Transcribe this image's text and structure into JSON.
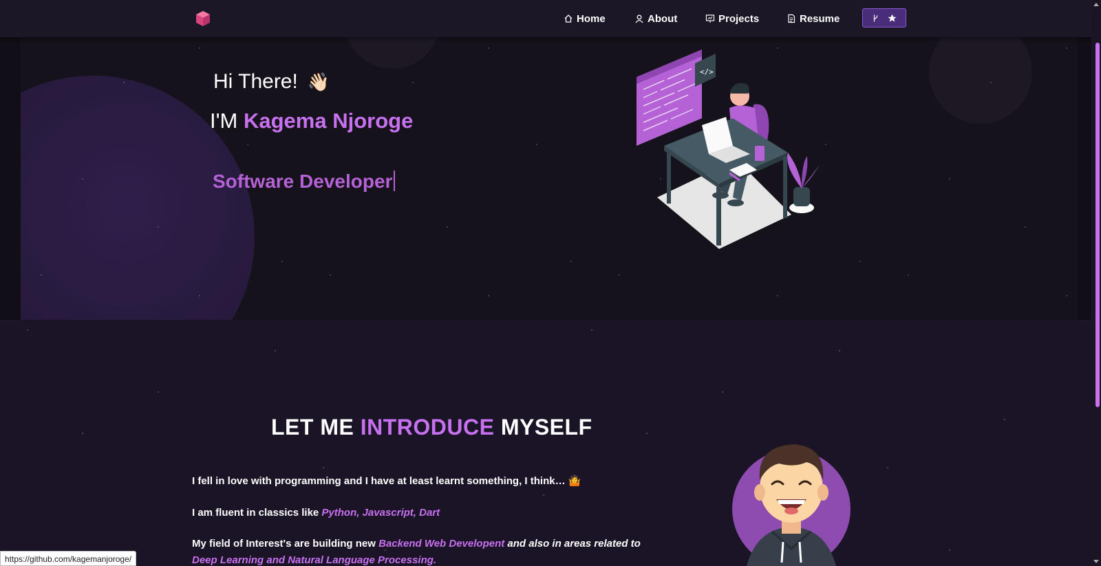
{
  "nav": {
    "items": [
      {
        "label": "Home",
        "icon": "home-icon"
      },
      {
        "label": "About",
        "icon": "user-icon"
      },
      {
        "label": "Projects",
        "icon": "projects-icon"
      },
      {
        "label": "Resume",
        "icon": "document-icon"
      }
    ],
    "github_button": {
      "icons": [
        "fork-icon",
        "star-icon"
      ]
    }
  },
  "hero": {
    "greeting": "Hi There!",
    "greeting_emoji": "👋🏻",
    "name_prefix": "I'M",
    "name": "Kagema Njoroge",
    "role": "Software Developer"
  },
  "intro": {
    "title_part1": "LET ME",
    "title_accent": "INTRODUCE",
    "title_part2": "MYSELF",
    "p1": "I fell in love with programming and I have at least learnt something, I think…",
    "p1_emoji": "🤷",
    "p2_prefix": "I am fluent in classics like",
    "p2_highlight": "Python, Javascript, Dart",
    "p3_prefix": "My field of Interest's are building new",
    "p3_highlight1": "Backend Web Developent",
    "p3_middle": "and also in areas related to",
    "p3_highlight2": "Deep Learning and Natural Language Processing."
  },
  "status_url": "https://github.com/kagemanjoroge/",
  "colors": {
    "accent": "#c770f0",
    "role": "#b562d6",
    "background": "#1b1427",
    "navbar": "#1c1727"
  }
}
